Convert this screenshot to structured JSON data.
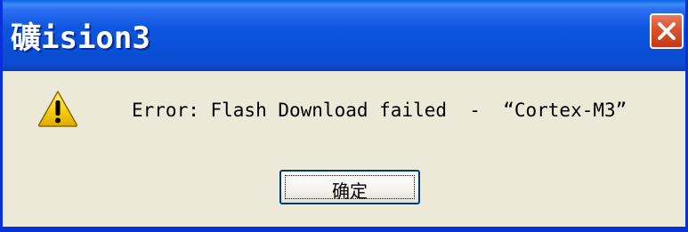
{
  "window": {
    "title": "礦ision3"
  },
  "titlebar": {
    "close_icon": "close-x-icon",
    "close_color": "#d8532d"
  },
  "body": {
    "icon": "warning-icon",
    "message": "Error: Flash Download failed  -  “Cortex-M3”"
  },
  "buttons": {
    "ok_label": "确定"
  },
  "colors": {
    "titlebar": "#0a4fd6",
    "background": "#ece9d8",
    "warning": "#f5c400"
  }
}
